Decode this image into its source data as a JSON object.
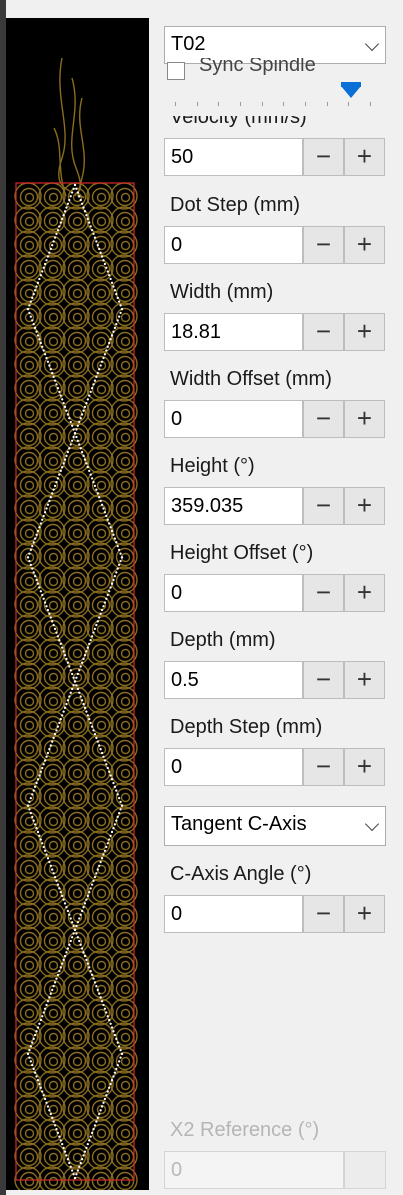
{
  "tool_select": {
    "value": "T02"
  },
  "sync_spindle": {
    "label": "Sync Spindle",
    "checked": false
  },
  "velocity_slider": {
    "tick_count": 10,
    "level": 0.9
  },
  "fields": {
    "velocity": {
      "label": "Velocity (mm/s)",
      "value": "50"
    },
    "dot_step": {
      "label": "Dot Step (mm)",
      "value": "0"
    },
    "width": {
      "label": "Width (mm)",
      "value": "18.81"
    },
    "width_offset": {
      "label": "Width Offset (mm)",
      "value": "0"
    },
    "height": {
      "label": "Height (°)",
      "value": "359.035"
    },
    "height_offset": {
      "label": "Height Offset (°)",
      "value": "0"
    },
    "depth": {
      "label": "Depth (mm)",
      "value": "0.5"
    },
    "depth_step": {
      "label": "Depth Step (mm)",
      "value": "0"
    },
    "c_axis_angle": {
      "label": "C-Axis Angle (°)",
      "value": "0"
    },
    "x2_reference": {
      "label": "X2 Reference (°)",
      "value": "0"
    }
  },
  "axis_mode_select": {
    "value": "Tangent C-Axis"
  },
  "spinner": {
    "minus": "−",
    "plus": "+"
  },
  "preview": {
    "background": "#000000",
    "pattern_color": "#8a6d1e",
    "boundary_color": "#d42a2a",
    "path_color": "#ffffff",
    "diamond_count": 4
  }
}
